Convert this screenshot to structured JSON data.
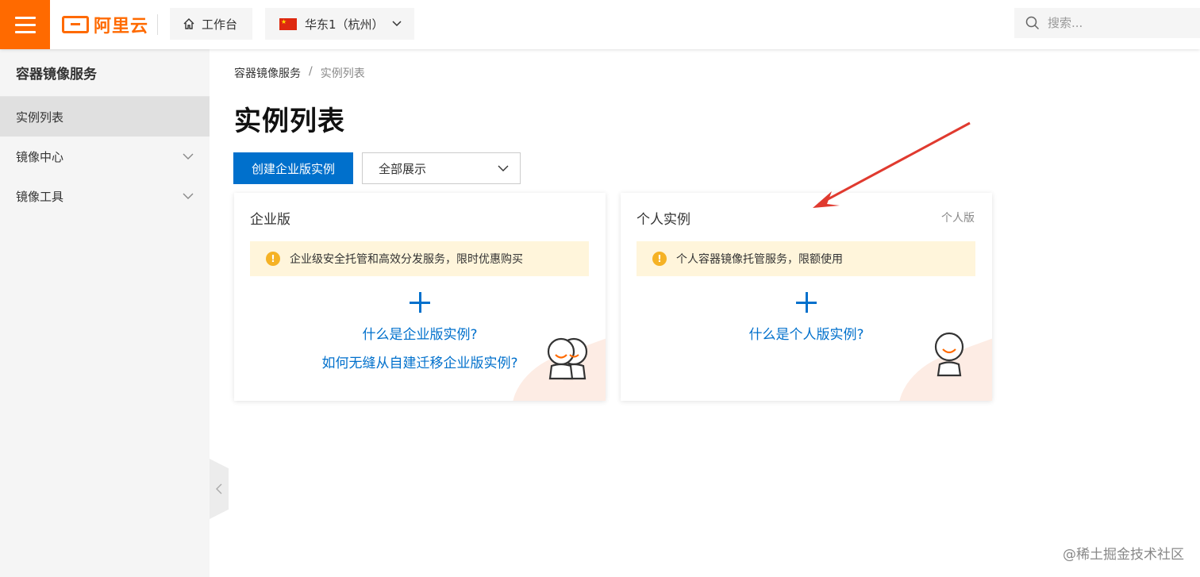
{
  "topbar": {
    "logo_text": "阿里云",
    "workbench_label": "工作台",
    "region_label": "华东1（杭州）",
    "search_placeholder": "搜索..."
  },
  "sidebar": {
    "title": "容器镜像服务",
    "items": [
      {
        "label": "实例列表",
        "active": true,
        "expandable": false
      },
      {
        "label": "镜像中心",
        "active": false,
        "expandable": true
      },
      {
        "label": "镜像工具",
        "active": false,
        "expandable": true
      }
    ]
  },
  "breadcrumb": {
    "root": "容器镜像服务",
    "separator": "/",
    "current": "实例列表"
  },
  "main": {
    "title": "实例列表",
    "create_button": "创建企业版实例",
    "filter_value": "全部展示"
  },
  "cards": {
    "enterprise": {
      "title": "企业版",
      "notice": "企业级安全托管和高效分发服务，限时优惠购买",
      "link1": "什么是企业版实例?",
      "link2": "如何无缝从自建迁移企业版实例?"
    },
    "personal": {
      "title": "个人实例",
      "tag": "个人版",
      "notice": "个人容器镜像托管服务，限额使用",
      "link1": "什么是个人版实例?"
    }
  },
  "annotation": {
    "arrow_color": "#e03a2f"
  },
  "watermark": "@稀土掘金技术社区",
  "colors": {
    "brand_orange": "#ff6a00",
    "primary_blue": "#0070cc",
    "notice_bg": "#fff5db",
    "warning_yellow": "#f5b225"
  }
}
